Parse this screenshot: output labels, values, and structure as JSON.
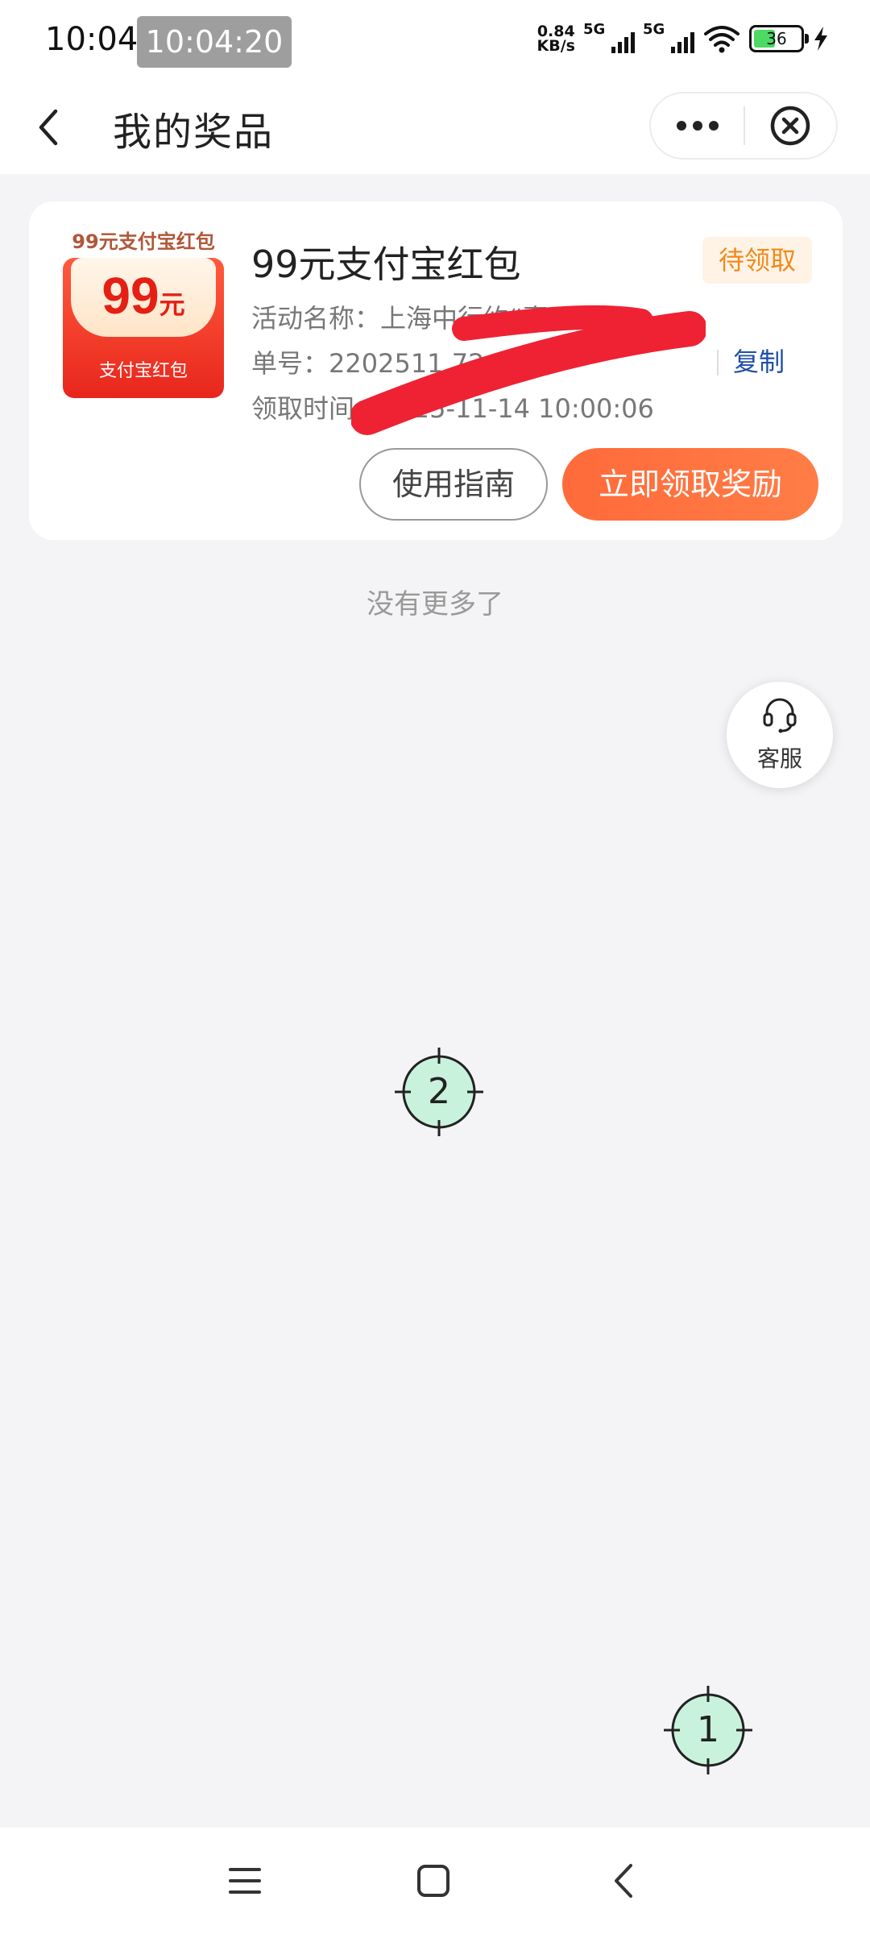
{
  "status_bar": {
    "time": "10:04",
    "clock_chip": "10:04:20",
    "net_speed_value": "0.84",
    "net_speed_unit": "KB/s",
    "sim1_label": "5G",
    "sim2_label": "5G",
    "battery_level": "36",
    "icons": [
      "wifi-icon",
      "battery-icon",
      "charging-bolt-icon"
    ]
  },
  "header": {
    "title": "我的奖品",
    "icons": [
      "back-arrow-icon",
      "more-dots-icon",
      "close-circle-icon"
    ]
  },
  "prize": {
    "voucher_caption": "99元支付宝红包",
    "voucher_amount": "99",
    "voucher_unit": "元",
    "voucher_brand": "支付宝红包",
    "name": "99元支付宝红包",
    "status": "待领取",
    "activity_label": "活动名称：",
    "activity_value": "上海中行约“惠”双十一",
    "order_label": "单号：",
    "order_value": "2202511 7241",
    "copy_label": "复制",
    "time_label": "领取时间：",
    "time_value": "2025-11-14 10:00:06",
    "guide_button": "使用指南",
    "claim_button": "立即领取奖励"
  },
  "list_end_text": "没有更多了",
  "service": {
    "label": "客服",
    "icon": "headset-icon"
  },
  "markers": {
    "marker_1": "1",
    "marker_2": "2"
  },
  "nav": {
    "icons": [
      "menu-icon",
      "home-square-icon",
      "back-chevron-icon"
    ]
  },
  "colors": {
    "accent_orange": "#ff6a3a",
    "status_orange": "#f08a1c",
    "link_blue": "#1f4fa8",
    "voucher_red": "#e8261c",
    "background": "#f4f4f6"
  }
}
